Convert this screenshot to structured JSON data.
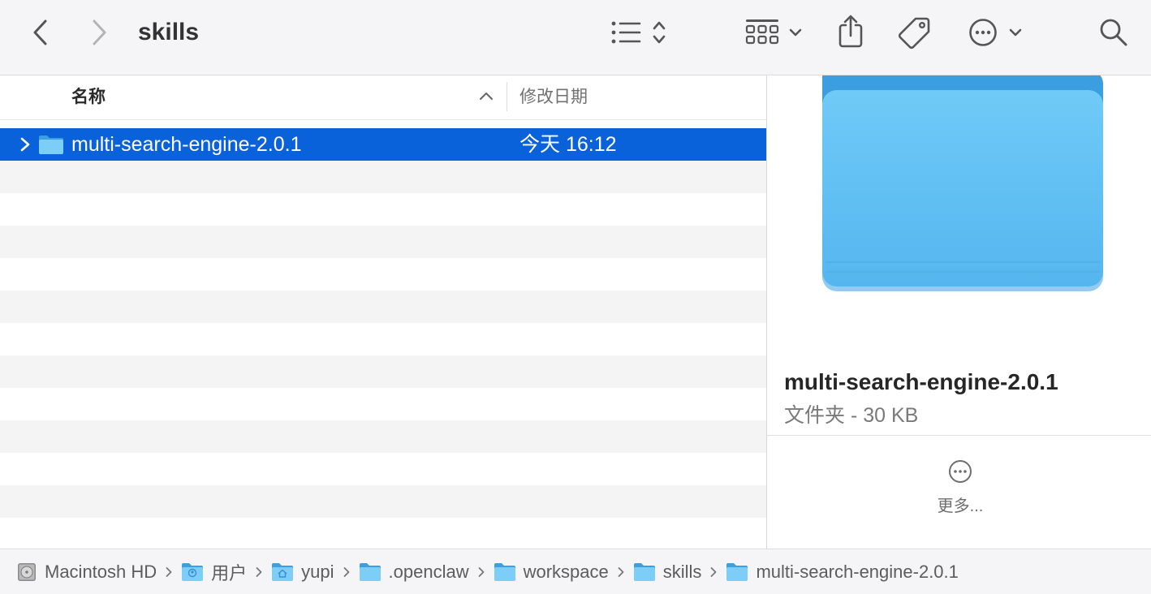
{
  "window": {
    "title": "skills"
  },
  "toolbar": {
    "back_icon": "chevron-left-icon",
    "forward_icon": "chevron-right-icon",
    "view_icon": "list-view-icon",
    "group_icon": "group-grid-icon",
    "share_icon": "share-icon",
    "tag_icon": "tag-icon",
    "action_icon": "ellipsis-circle-icon",
    "search_icon": "search-icon"
  },
  "list": {
    "columns": {
      "name": "名称",
      "date_modified": "修改日期"
    },
    "sort": "ascending",
    "rows": [
      {
        "name": "multi-search-engine-2.0.1",
        "date": "今天 16:12",
        "kind": "folder",
        "selected": true
      }
    ]
  },
  "preview": {
    "name": "multi-search-engine-2.0.1",
    "kind_size": "文件夹 - 30 KB",
    "more_label": "更多..."
  },
  "pathbar": {
    "items": [
      {
        "label": "Macintosh HD",
        "icon": "hard-drive-icon"
      },
      {
        "label": "用户",
        "icon": "users-folder-icon"
      },
      {
        "label": "yupi",
        "icon": "home-folder-icon"
      },
      {
        "label": ".openclaw",
        "icon": "folder-icon"
      },
      {
        "label": "workspace",
        "icon": "folder-icon"
      },
      {
        "label": "skills",
        "icon": "folder-icon"
      },
      {
        "label": "multi-search-engine-2.0.1",
        "icon": "folder-icon"
      }
    ]
  },
  "colors": {
    "selection": "#0a62da",
    "folder_blue": "#5ab8ee",
    "toolbar_bg": "#f5f4f6"
  }
}
